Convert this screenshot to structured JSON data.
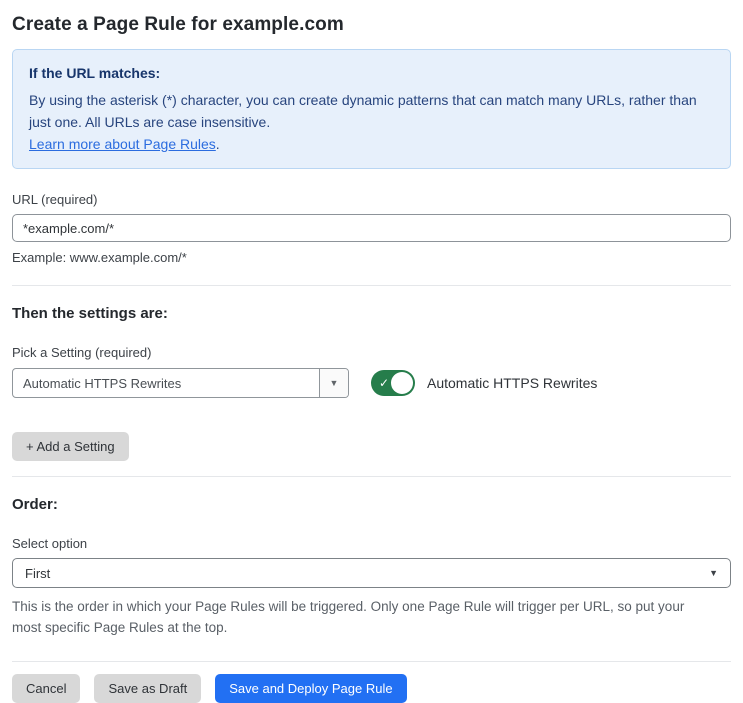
{
  "page": {
    "title": "Create a Page Rule for example.com"
  },
  "info_box": {
    "heading": "If the URL matches:",
    "body": "By using the asterisk (*) character, you can create dynamic patterns that can match many URLs, rather than just one. All URLs are case insensitive.",
    "link": "Learn more about Page Rules",
    "link_suffix": "."
  },
  "url_field": {
    "label": "URL (required)",
    "value": "*example.com/*",
    "helper": "Example: www.example.com/*"
  },
  "settings": {
    "heading": "Then the settings are:",
    "pick_label": "Pick a Setting (required)",
    "selected_setting": "Automatic HTTPS Rewrites",
    "dropdown_icon": "▼",
    "toggle": {
      "state": "on",
      "check_icon": "✓",
      "label": "Automatic HTTPS Rewrites"
    },
    "add_button_label": "+ Add a Setting"
  },
  "order": {
    "heading": "Order:",
    "label": "Select option",
    "selected_option": "First",
    "dropdown_icon": "▼",
    "helper": "This is the order in which your Page Rules will be triggered. Only one Page Rule will trigger per URL, so put your most specific Page Rules at the top."
  },
  "footer": {
    "cancel_label": "Cancel",
    "save_draft_label": "Save as Draft",
    "deploy_label": "Save and Deploy Page Rule"
  },
  "colors": {
    "accent_blue": "#2270f3",
    "info_bg": "#e7f0fb",
    "info_border": "#b9d6f3",
    "info_text": "#28457e",
    "link_blue": "#2b6cdf",
    "toggle_green": "#267d4b",
    "button_gray": "#d8d8d8"
  }
}
